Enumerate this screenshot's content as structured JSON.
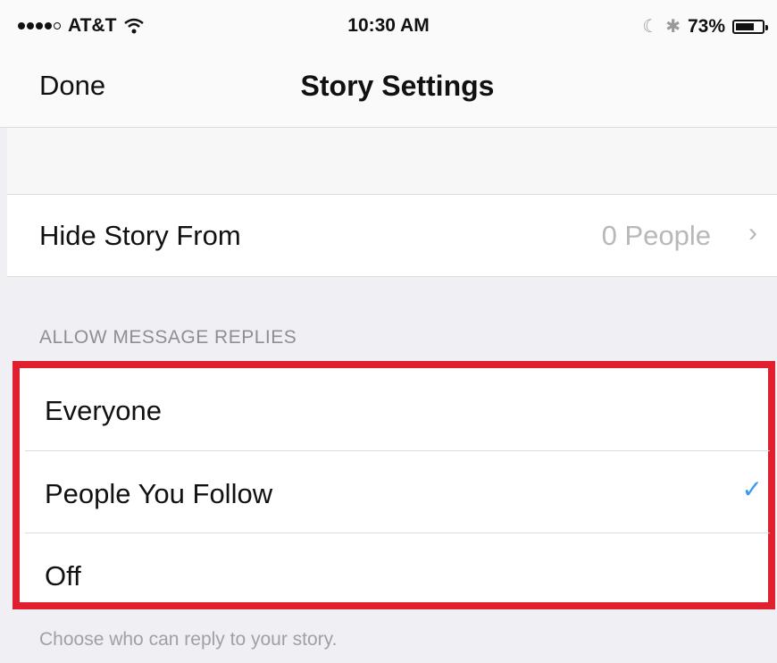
{
  "status_bar": {
    "carrier": "AT&T",
    "time": "10:30 AM",
    "battery_percent": "73%",
    "battery_level": 0.73,
    "signal_icon": "signal-dots-icon",
    "wifi_icon": "wifi-icon",
    "moon_icon": "moon-icon",
    "bluetooth_icon": "bluetooth-icon"
  },
  "nav": {
    "done_label": "Done",
    "title": "Story Settings"
  },
  "hide_story": {
    "label": "Hide Story From",
    "value": "0 People",
    "chevron": "›"
  },
  "message_replies": {
    "header": "ALLOW MESSAGE REPLIES",
    "options": [
      {
        "label": "Everyone",
        "selected": false
      },
      {
        "label": "People You Follow",
        "selected": true
      },
      {
        "label": "Off",
        "selected": false
      }
    ],
    "check_glyph": "✓",
    "footer": "Choose who can reply to your story."
  },
  "colors": {
    "accent": "#3897f0",
    "highlight_border": "#e0202f",
    "background": "#efeff4"
  }
}
